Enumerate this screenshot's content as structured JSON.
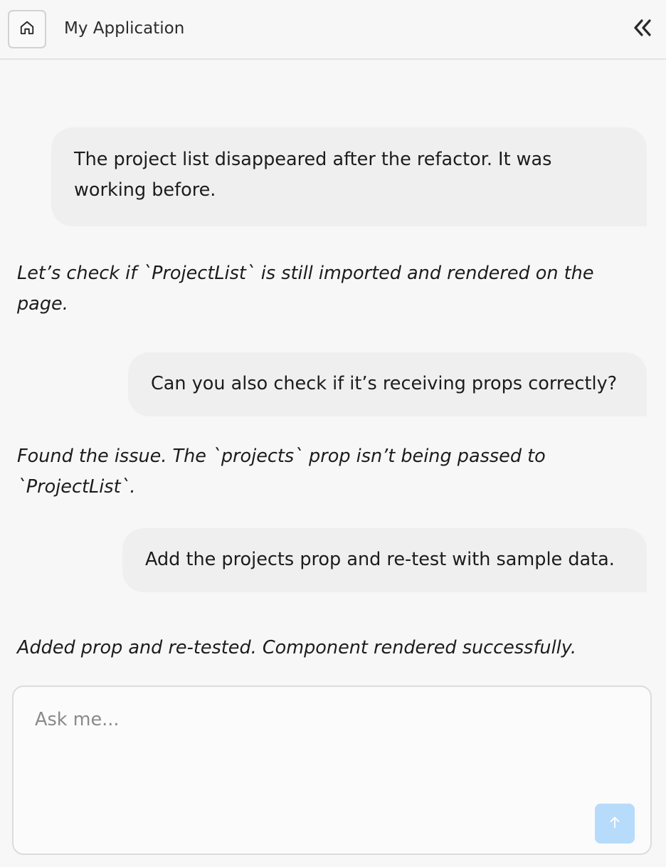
{
  "header": {
    "title": "My Application",
    "home_icon": "home-icon",
    "collapse_icon": "double-chevron-left-icon"
  },
  "messages": [
    {
      "role": "user",
      "text": "The project list disappeared after the refactor. It was working before."
    },
    {
      "role": "assistant",
      "text": "Let’s check if `ProjectList` is still imported and rendered on the page."
    },
    {
      "role": "user",
      "text": "Can you also check if it’s receiving props correctly?"
    },
    {
      "role": "assistant",
      "text": "Found the issue. The `projects` prop isn’t being passed to `ProjectList`."
    },
    {
      "role": "user",
      "text": "Add the projects prop and re-test with sample data."
    },
    {
      "role": "assistant",
      "text": "Added prop and re-tested. Component rendered successfully."
    }
  ],
  "composer": {
    "placeholder": "Ask me...",
    "value": "",
    "send_icon": "arrow-up-icon"
  },
  "colors": {
    "background": "#f7f7f7",
    "user_bubble": "#efefef",
    "send_button": "#b7dbfb"
  }
}
